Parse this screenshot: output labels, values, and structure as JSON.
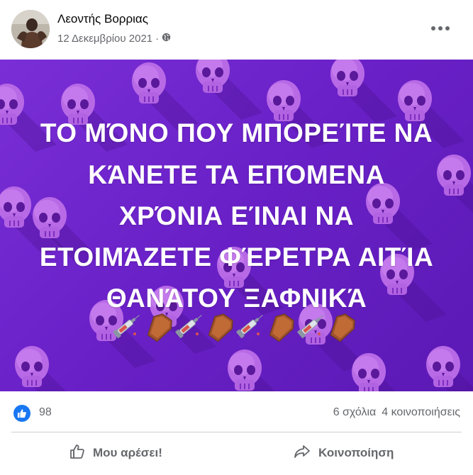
{
  "post": {
    "author": "Λεοντής Βορριας",
    "date": "12 Δεκεμβρίου 2021",
    "separator": "·",
    "privacy_icon": "globe-icon",
    "menu_icon": "more-horizontal-icon",
    "text_lines": [
      "ΤΟ ΜΌΝΟ ΠΟΥ ΜΠΟΡΕΊΤΕ ΝΑ",
      "ΚΆΝΕΤΕ ΤΑ ΕΠΌΜΕΝΑ",
      "ΧΡΌΝΙΑ ΕΊΝΑΙ ΝΑ",
      "ΕΤΟΙΜΆΖΕΤΕ ΦΈΡΕΤΡΑ ΑΙΤΊΑ",
      "ΘΑΝΆΤΟΥ ΞΑΦΝΙΚΆ"
    ],
    "emojis": [
      "syringe",
      "coffin",
      "syringe",
      "coffin",
      "syringe",
      "coffin",
      "syringe",
      "coffin"
    ],
    "background_color": "#6a21c8"
  },
  "stats": {
    "likes": "98",
    "comments": "6 σχόλια",
    "shares": "4 κοινοποιήσεις"
  },
  "actions": {
    "like_label": "Μου αρέσει!",
    "share_label": "Κοινοποίηση"
  },
  "colors": {
    "accent": "#1877f2",
    "secondary_text": "#65676b"
  }
}
